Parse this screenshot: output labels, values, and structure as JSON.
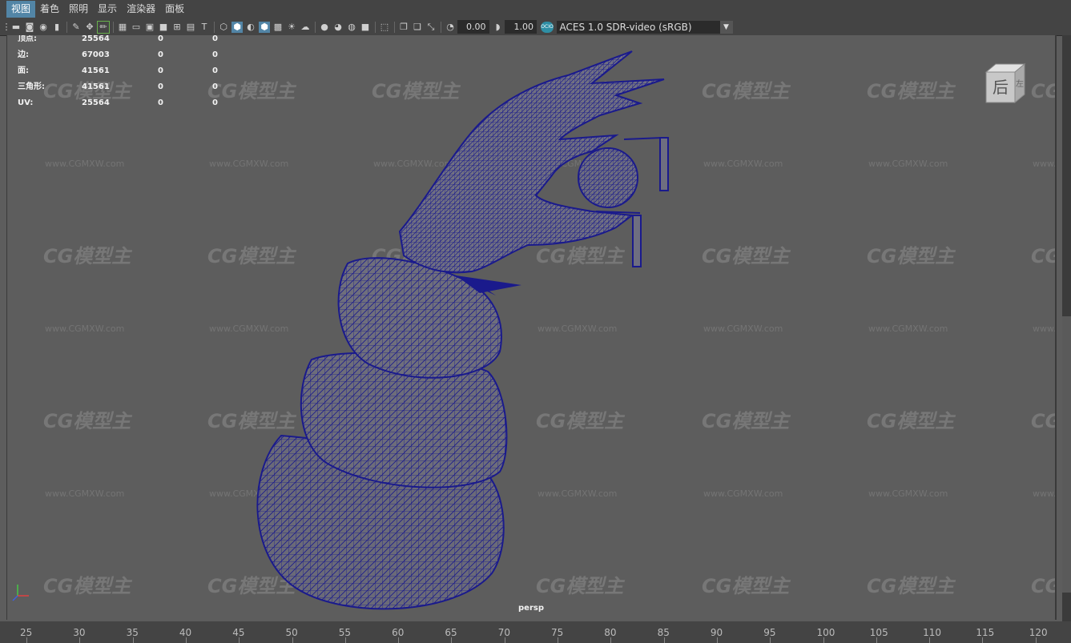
{
  "menubar": {
    "items": [
      "视图",
      "着色",
      "照明",
      "显示",
      "渲染器",
      "面板"
    ]
  },
  "toolbar": {
    "exposure_value": "0.00",
    "gamma_value": "1.00",
    "colorspace_badge": "OCIO",
    "colorspace_label": "ACES 1.0 SDR-video (sRGB)"
  },
  "hud": {
    "rows": [
      {
        "label": "顶点:",
        "v1": "25564",
        "v2": "0",
        "v3": "0"
      },
      {
        "label": "边:",
        "v1": "67003",
        "v2": "0",
        "v3": "0"
      },
      {
        "label": "面:",
        "v1": "41561",
        "v2": "0",
        "v3": "0"
      },
      {
        "label": "三角形:",
        "v1": "41561",
        "v2": "0",
        "v3": "0"
      },
      {
        "label": "UV:",
        "v1": "25564",
        "v2": "0",
        "v3": "0"
      }
    ]
  },
  "viewcube": {
    "face_label": "后",
    "side_label": "左"
  },
  "camera_label": "persp",
  "watermark": {
    "logo": "CG模型主",
    "url": "www.CGMXW.com"
  },
  "ruler": {
    "ticks": [
      "25",
      "30",
      "35",
      "40",
      "45",
      "50",
      "55",
      "60",
      "65",
      "70",
      "75",
      "80",
      "85",
      "90",
      "95",
      "100",
      "105",
      "110",
      "115",
      "120"
    ]
  },
  "colors": {
    "wireframe": "#1a1a8c",
    "accent": "#5285a6",
    "viewport_bg": "#5d5d5d"
  }
}
